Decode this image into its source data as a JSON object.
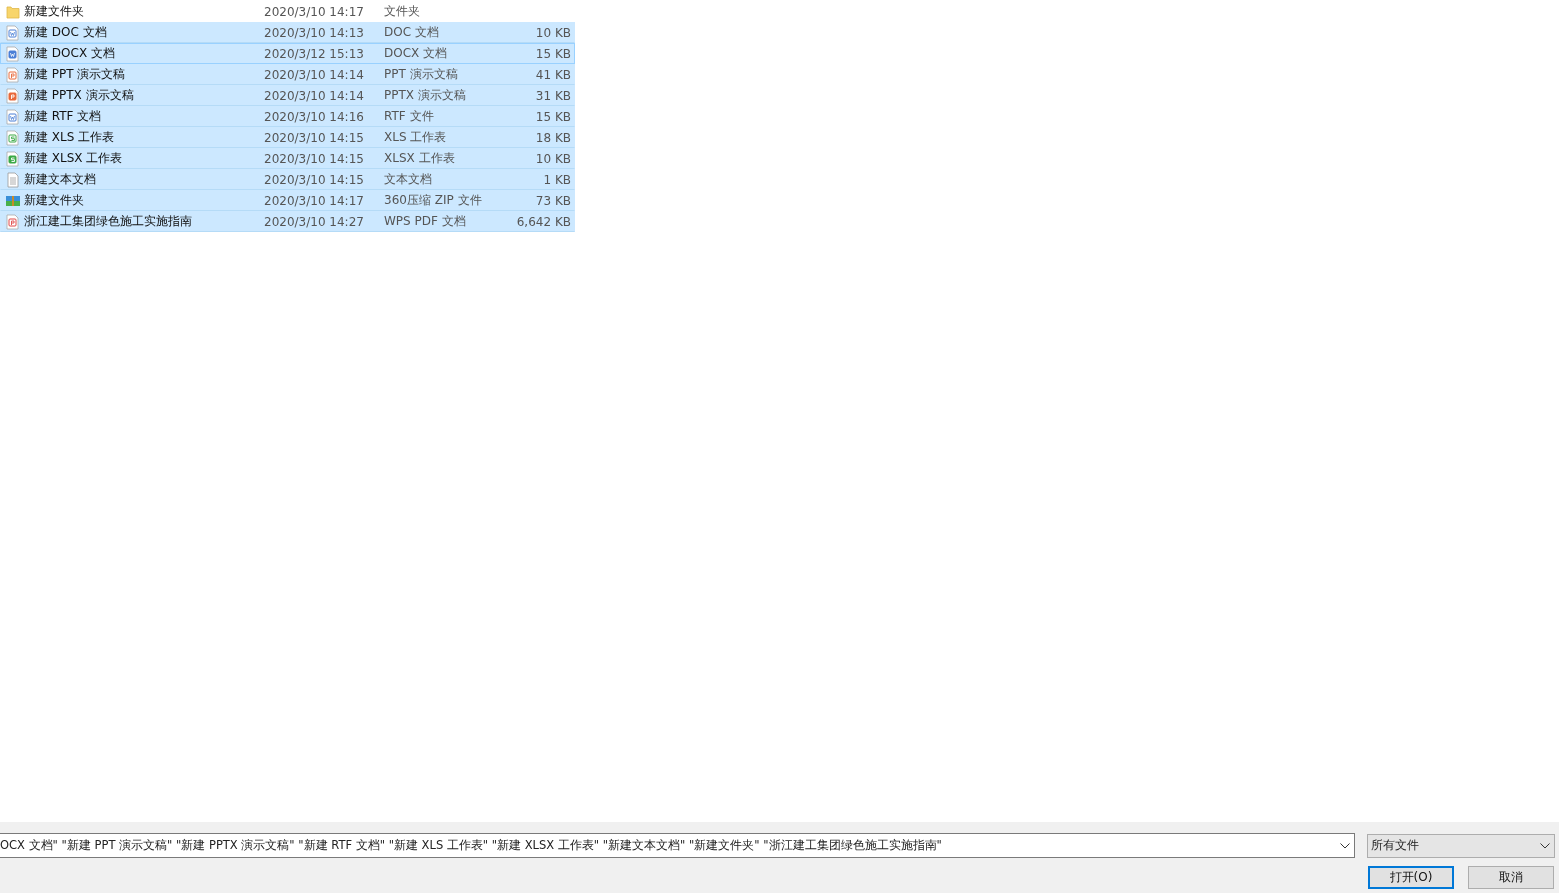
{
  "files": [
    {
      "name": "新建文件夹",
      "date": "2020/3/10 14:17",
      "type": "文件夹",
      "kind": "folder",
      "selected": false,
      "focused": false
    },
    {
      "name": "新建 DOC 文档",
      "date": "2020/3/10 14:13",
      "type": "DOC 文档",
      "size": "10 KB",
      "kind": "doc",
      "selected": true,
      "focused": false
    },
    {
      "name": "新建 DOCX 文档",
      "date": "2020/3/12 15:13",
      "type": "DOCX 文档",
      "size": "15 KB",
      "kind": "docx",
      "selected": true,
      "focused": true
    },
    {
      "name": "新建 PPT 演示文稿",
      "date": "2020/3/10 14:14",
      "type": "PPT 演示文稿",
      "size": "41 KB",
      "kind": "ppt",
      "selected": true,
      "focused": false
    },
    {
      "name": "新建 PPTX 演示文稿",
      "date": "2020/3/10 14:14",
      "type": "PPTX 演示文稿",
      "size": "31 KB",
      "kind": "pptx",
      "selected": true,
      "focused": false
    },
    {
      "name": "新建 RTF 文档",
      "date": "2020/3/10 14:16",
      "type": "RTF 文件",
      "size": "15 KB",
      "kind": "doc",
      "selected": true,
      "focused": false
    },
    {
      "name": "新建 XLS 工作表",
      "date": "2020/3/10 14:15",
      "type": "XLS 工作表",
      "size": "18 KB",
      "kind": "xls",
      "selected": true,
      "focused": false
    },
    {
      "name": "新建 XLSX 工作表",
      "date": "2020/3/10 14:15",
      "type": "XLSX 工作表",
      "size": "10 KB",
      "kind": "xlsx",
      "selected": true,
      "focused": false
    },
    {
      "name": "新建文本文档",
      "date": "2020/3/10 14:15",
      "type": "文本文档",
      "size": "1 KB",
      "kind": "txt",
      "selected": true,
      "focused": false
    },
    {
      "name": "新建文件夹",
      "date": "2020/3/10 14:17",
      "type": "360压缩 ZIP 文件",
      "size": "73 KB",
      "kind": "zip",
      "selected": true,
      "focused": false
    },
    {
      "name": "浙江建工集团绿色施工实施指南",
      "date": "2020/3/10 14:27",
      "type": "WPS PDF 文档",
      "size": "6,642 KB",
      "kind": "pdf",
      "selected": true,
      "focused": false
    }
  ],
  "file_name_field": {
    "value": "OCX 文档\" \"新建 PPT 演示文稿\" \"新建 PPTX 演示文稿\" \"新建 RTF 文档\" \"新建 XLS 工作表\" \"新建 XLSX 工作表\" \"新建文本文档\" \"新建文件夹\" \"浙江建工集团绿色施工实施指南\""
  },
  "file_type_dropdown": {
    "value": "所有文件"
  },
  "buttons": [
    {
      "label": "打开(O)",
      "default": true
    },
    {
      "label": "取消",
      "default": false
    }
  ]
}
